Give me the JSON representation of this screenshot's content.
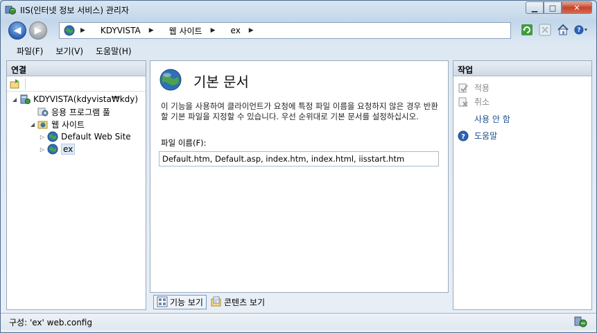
{
  "window": {
    "title": "IIS(인터넷 정보 서비스) 관리자",
    "minimize_glyph": "▁",
    "maximize_glyph": "□",
    "close_glyph": "✕"
  },
  "nav": {
    "back_glyph": "◀",
    "forward_glyph": "▶",
    "breadcrumbs": [
      "KDYVISTA",
      "웹 사이트",
      "ex"
    ]
  },
  "menu": {
    "items": [
      "파일(F)",
      "보기(V)",
      "도움말(H)"
    ]
  },
  "connections": {
    "header": "연결",
    "tree": [
      {
        "label": "KDYVISTA(kdyvista₩kdy)",
        "icon": "server-icon",
        "expander": "◢"
      },
      {
        "label": "응용 프로그램 풀",
        "icon": "app-pool-icon",
        "expander": ""
      },
      {
        "label": "웹 사이트",
        "icon": "sites-folder-icon",
        "expander": "◢"
      },
      {
        "label": "Default Web Site",
        "icon": "globe-icon",
        "expander": "▷"
      },
      {
        "label": "ex",
        "icon": "globe-icon",
        "expander": "▷"
      }
    ]
  },
  "main": {
    "title": "기본 문서",
    "description": "이 기능을 사용하여 클라이언트가 요청에 특정 파일 이름을 요청하지 않은 경우 반환할 기본 파일을 지정할 수 있습니다. 우선 순위대로 기본 문서를 설정하십시오.",
    "file_name_label": "파일 이름(F):",
    "file_name_value": "Default.htm, Default.asp, index.htm, index.html, iisstart.htm"
  },
  "view_tabs": {
    "features": "기능 보기",
    "content": "콘텐츠 보기"
  },
  "actions": {
    "header": "작업",
    "apply": "적용",
    "cancel": "취소",
    "disable": "사용 안 함",
    "help": "도움말"
  },
  "status": {
    "text": "구성: 'ex' web.config"
  },
  "colors": {
    "link": "#1a4d8c",
    "disabled": "#8a8a8a",
    "close_button": "#c5442c"
  }
}
